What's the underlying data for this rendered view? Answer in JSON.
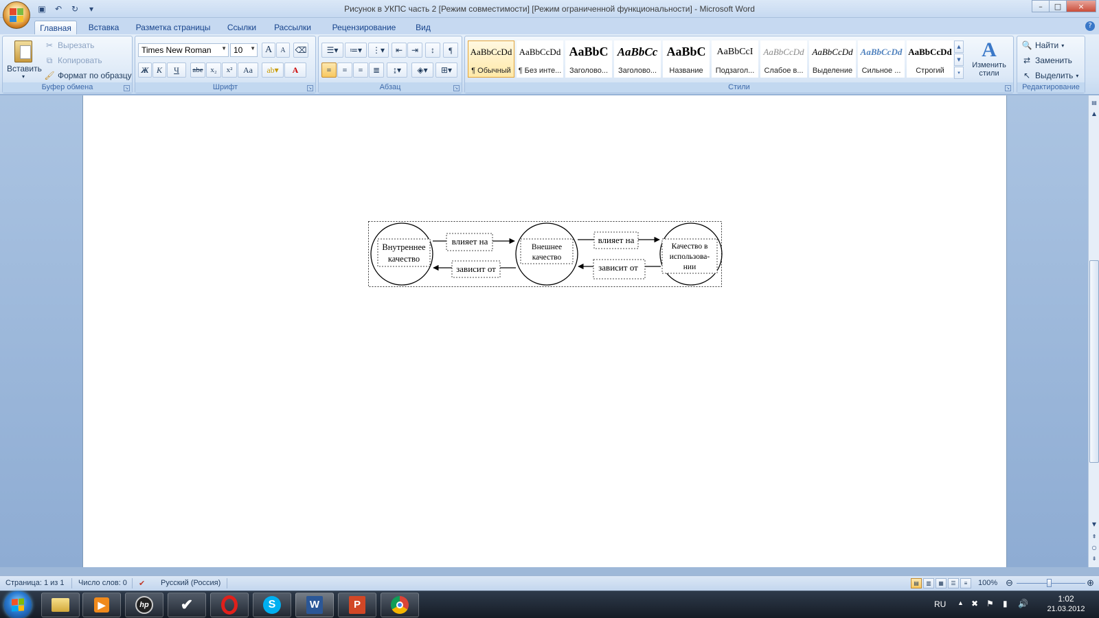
{
  "window": {
    "title": "Рисунок в УКПС часть 2 [Режим совместимости] [Режим ограниченной функциональности] - Microsoft Word",
    "controls": [
      "–",
      "□",
      "×"
    ]
  },
  "tabs": [
    "Главная",
    "Вставка",
    "Разметка страницы",
    "Ссылки",
    "Рассылки",
    "Рецензирование",
    "Вид"
  ],
  "clipboard": {
    "paste": "Вставить",
    "cut": "Вырезать",
    "copy": "Копировать",
    "format_painter": "Формат по образцу",
    "label": "Буфер обмена"
  },
  "font": {
    "name": "Times New Roman",
    "size": "10",
    "label": "Шрифт",
    "bold": "Ж",
    "italic": "К",
    "underline": "Ч",
    "strike": "abe",
    "sub": "x₂",
    "sup": "x²",
    "case": "Aa",
    "grow": "A",
    "shrink": "A",
    "color_letter": "A"
  },
  "paragraph": {
    "label": "Абзац",
    "pilcrow": "¶"
  },
  "styles": {
    "label": "Стили",
    "items": [
      {
        "sample": "AaBbCcDd",
        "name": "¶ Обычный"
      },
      {
        "sample": "AaBbCcDd",
        "name": "¶ Без инте..."
      },
      {
        "sample": "AaBbC",
        "name": "Заголово..."
      },
      {
        "sample": "AaBbCc",
        "name": "Заголово..."
      },
      {
        "sample": "AaBbC",
        "name": "Название"
      },
      {
        "sample": "AaBbCcI",
        "name": "Подзагол..."
      },
      {
        "sample": "AaBbCcDd",
        "name": "Слабое в..."
      },
      {
        "sample": "AaBbCcDd",
        "name": "Выделение"
      },
      {
        "sample": "AaBbCcDd",
        "name": "Сильное ..."
      },
      {
        "sample": "AaBbCcDd",
        "name": "Строгий"
      }
    ],
    "change_styles_line1": "Изменить",
    "change_styles_line2": "стили"
  },
  "editing": {
    "label": "Редактирование",
    "find": "Найти",
    "replace": "Заменить",
    "select": "Выделить"
  },
  "diagram": {
    "node1_line1": "Внутреннее",
    "node1_line2": "качество",
    "node2_line1": "Внешнее",
    "node2_line2": "качество",
    "node3_line1": "Качество в",
    "node3_line2": "использова-",
    "node3_line3": "нии",
    "edge1": "влияет на",
    "edge2": "влияет на",
    "edge3": "зависит от",
    "edge4": "зависит от"
  },
  "status": {
    "page": "Страница: 1 из 1",
    "words": "Число слов: 0",
    "language": "Русский (Россия)",
    "zoom": "100%"
  },
  "taskbar": {
    "lang": "RU",
    "time": "1:02",
    "date": "21.03.2012",
    "apps": [
      "Explorer",
      "Media",
      "HP",
      "Tasks",
      "Opera",
      "Skype",
      "Word",
      "PowerPoint",
      "Chrome"
    ]
  },
  "colors": {
    "ribbon_bg": "#dbe8f7",
    "accent": "#15428b",
    "active_style": "#ffe9a8"
  }
}
